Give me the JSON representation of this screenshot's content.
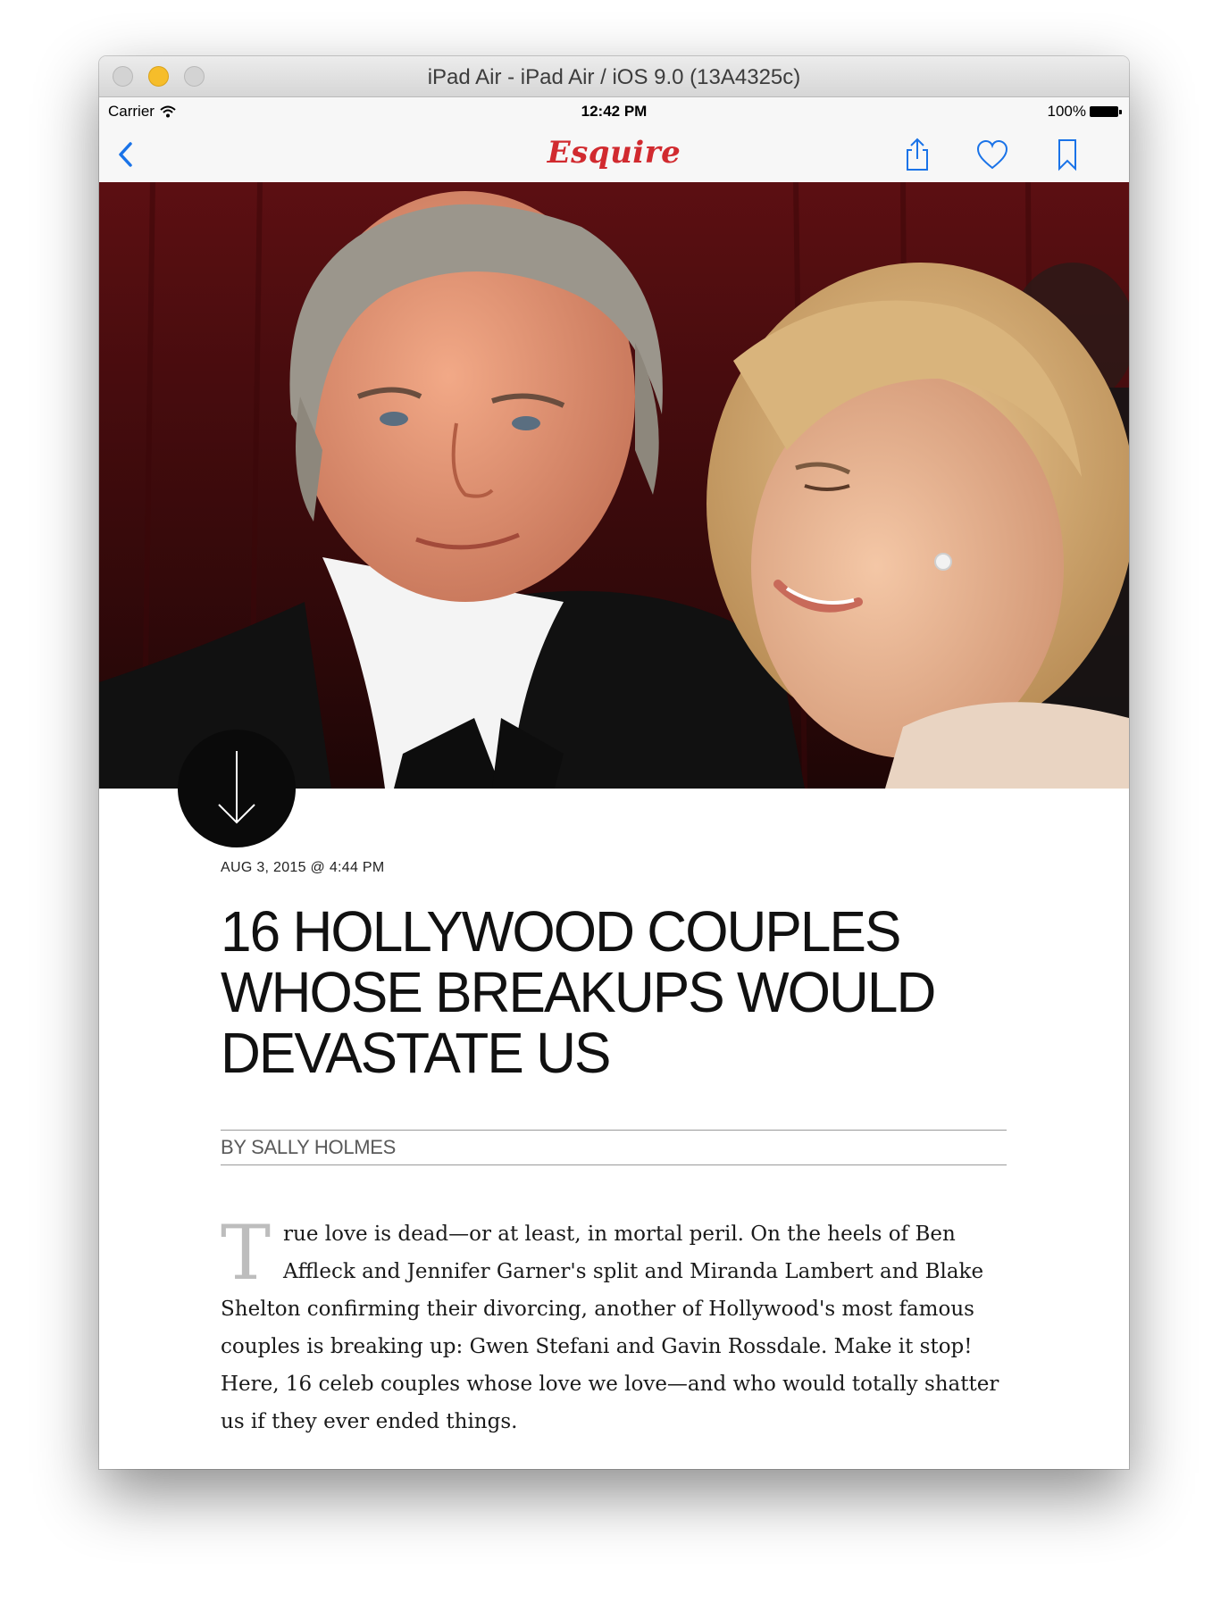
{
  "window": {
    "title": "iPad Air - iPad Air / iOS 9.0 (13A4325c)"
  },
  "status_bar": {
    "carrier": "Carrier",
    "time": "12:42 PM",
    "battery": "100%"
  },
  "nav": {
    "logo": "Esquire",
    "icons": [
      "chevron-left-icon",
      "share-icon",
      "heart-icon",
      "bookmark-icon"
    ],
    "accent_color": "#1a73e8",
    "logo_color": "#d12a2f"
  },
  "article": {
    "date": "AUG 3, 2015 @ 4:44 PM",
    "headline": "16 HOLLYWOOD COUPLES WHOSE BREAKUPS WOULD DEVASTATE US",
    "byline": "BY SALLY HOLMES",
    "drop_cap": "T",
    "body": "rue love is dead—or at least, in mortal peril. On the heels of Ben Affleck and Jennifer Garner's split and Miranda Lambert and Blake Shelton confirming their divorcing, another of Hollywood's most famous couples is breaking up: Gwen Stefani and Gavin Rossdale. Make it stop! Here, 16 celeb couples whose love we love—and who would totally shatter us if they ever ended things."
  }
}
